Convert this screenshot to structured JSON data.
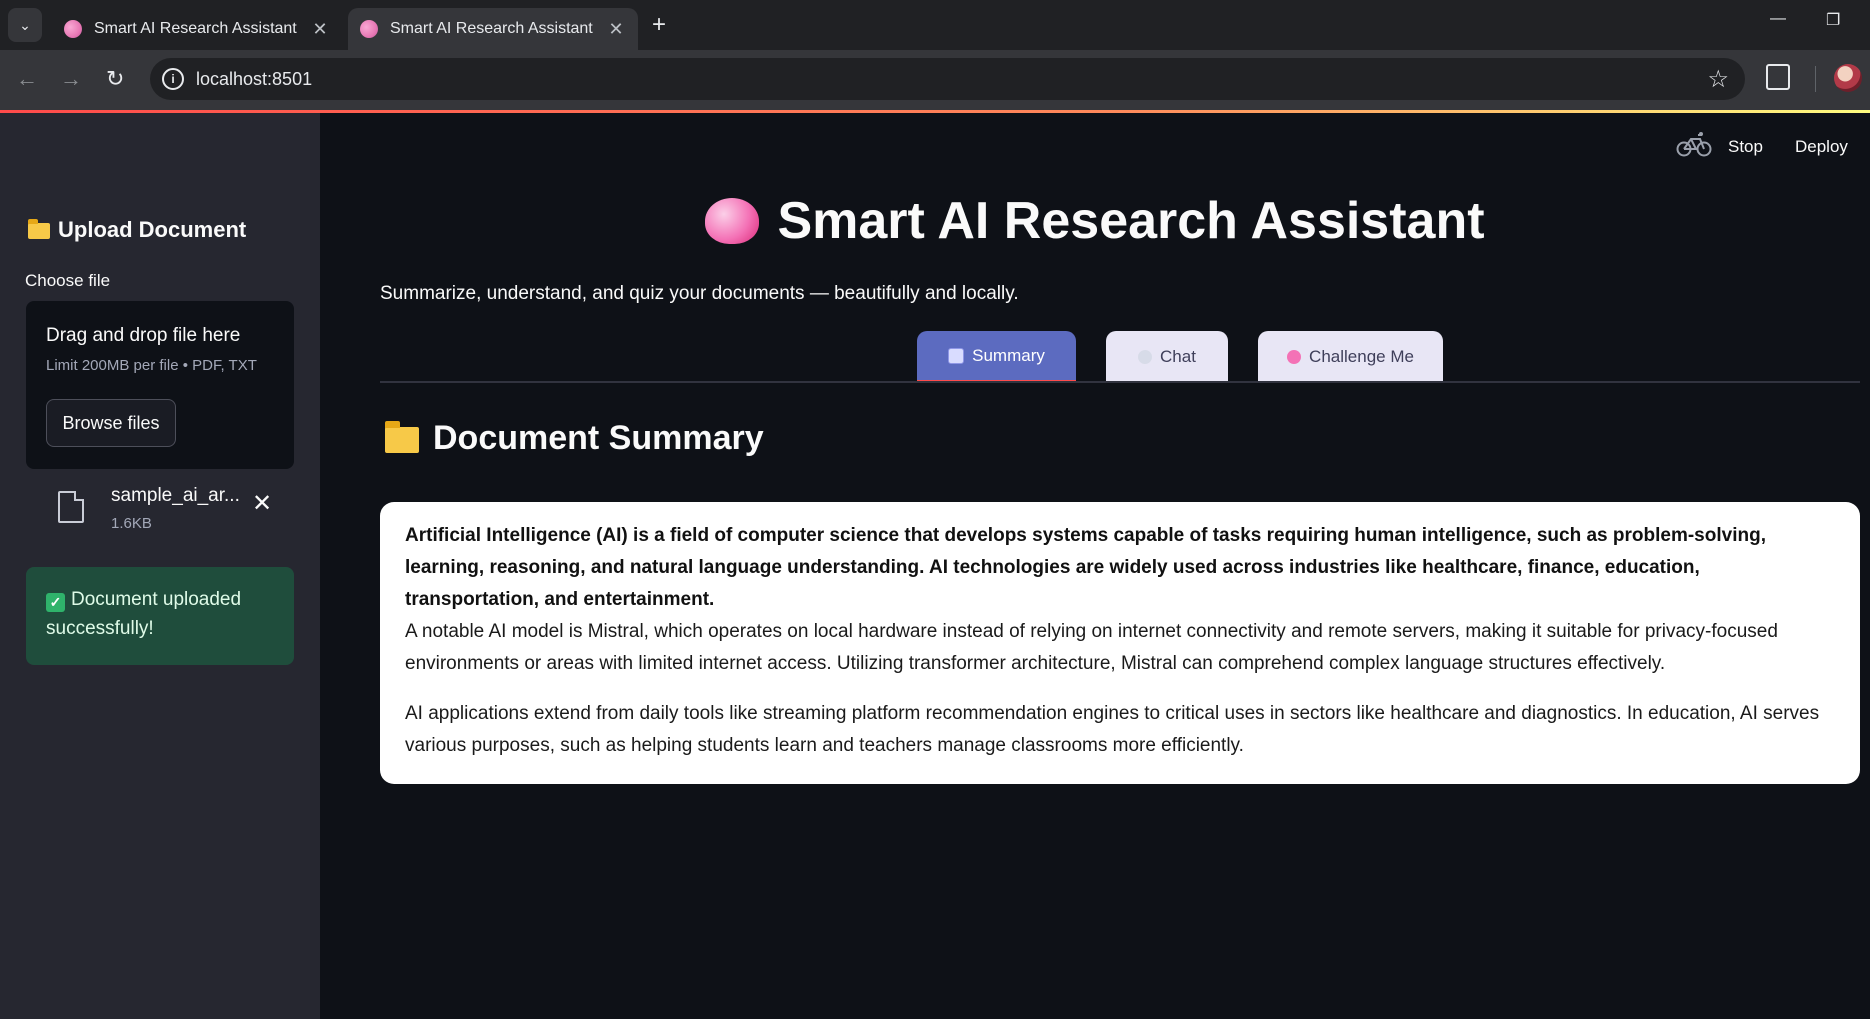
{
  "browser": {
    "tabs": [
      {
        "title": "Smart AI Research Assistant",
        "active": false
      },
      {
        "title": "Smart AI Research Assistant",
        "active": true
      }
    ],
    "new_tab_icon": "plus-icon",
    "url": "localhost:8501"
  },
  "sidebar": {
    "header": "Upload Document",
    "uploader_label": "Choose file",
    "dropzone_title": "Drag and drop file here",
    "dropzone_limit": "Limit 200MB per file • PDF, TXT",
    "browse_label": "Browse files",
    "file": {
      "name": "sample_ai_ar...",
      "size": "1.6KB"
    },
    "success_message": "Document uploaded successfully!"
  },
  "header": {
    "stop_label": "Stop",
    "deploy_label": "Deploy"
  },
  "main": {
    "title": "Smart AI Research Assistant",
    "subtitle": "Summarize, understand, and quiz your documents — beautifully and locally.",
    "tabs": [
      {
        "label": "Summary",
        "active": true
      },
      {
        "label": "Chat",
        "active": false
      },
      {
        "label": "Challenge Me",
        "active": false
      }
    ],
    "section_title": "Document Summary",
    "summary": {
      "p1_bold": "Artificial Intelligence (AI) is a field of computer science that develops systems capable of tasks requiring human intelligence, such as problem-solving, learning, reasoning, and natural language understanding. AI technologies are widely used across industries like healthcare, finance, education, transportation, and entertainment.",
      "p1_rest": "A notable AI model is Mistral, which operates on local hardware instead of relying on internet connectivity and remote servers, making it suitable for privacy-focused environments or areas with limited internet access. Utilizing transformer architecture, Mistral can comprehend complex language structures effectively.",
      "p2": "AI applications extend from daily tools like streaming platform recommendation engines to critical uses in sectors like healthcare and diagnostics. In education, AI serves various purposes, such as helping students learn and teachers manage classrooms more efficiently."
    }
  },
  "colors": {
    "app_bg": "#0e1117",
    "sidebar_bg": "#262730",
    "active_tab": "#5c6bc0",
    "inactive_tab": "#e8e6f5",
    "success_bg": "#1f4d3c",
    "accent": "#ff4b4b"
  }
}
